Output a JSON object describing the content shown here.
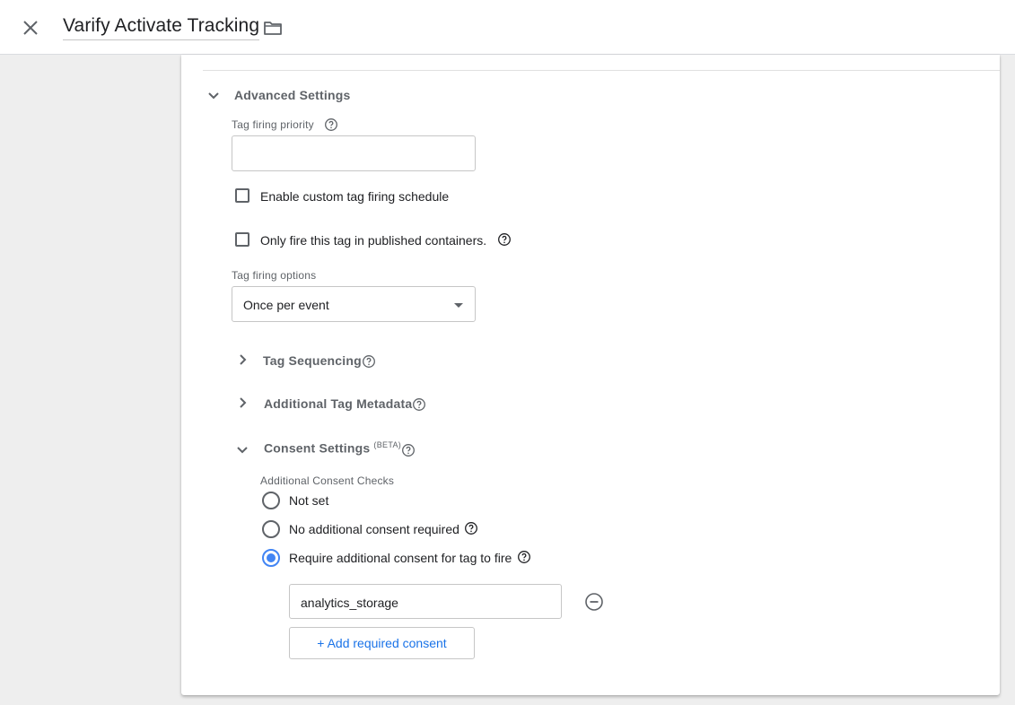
{
  "header": {
    "title": "Varify Activate Tracking",
    "close_icon": "close-icon",
    "folder_icon": "folder-icon"
  },
  "advanced": {
    "label": "Advanced Settings",
    "expanded": true,
    "priority": {
      "label": "Tag firing priority",
      "value": ""
    },
    "custom_schedule": {
      "label": "Enable custom tag firing schedule",
      "checked": false
    },
    "published_only": {
      "label": "Only fire this tag in published containers.",
      "checked": false
    },
    "firing_options": {
      "label": "Tag firing options",
      "value": "Once per event"
    },
    "sequencing": {
      "label": "Tag Sequencing",
      "expanded": false
    },
    "metadata": {
      "label": "Additional Tag Metadata",
      "expanded": false
    },
    "consent": {
      "label": "Consent Settings",
      "badge": "(BETA)",
      "expanded": true,
      "checks_label": "Additional Consent Checks",
      "options": [
        {
          "label": "Not set",
          "selected": false
        },
        {
          "label": "No additional consent required",
          "selected": false
        },
        {
          "label": "Require additional consent for tag to fire",
          "selected": true
        }
      ],
      "required": [
        {
          "value": "analytics_storage"
        }
      ],
      "add_label": "+ Add required consent"
    }
  },
  "colors": {
    "accent": "#4285f4",
    "link": "#1a73e8",
    "background": "#eeeeee"
  }
}
